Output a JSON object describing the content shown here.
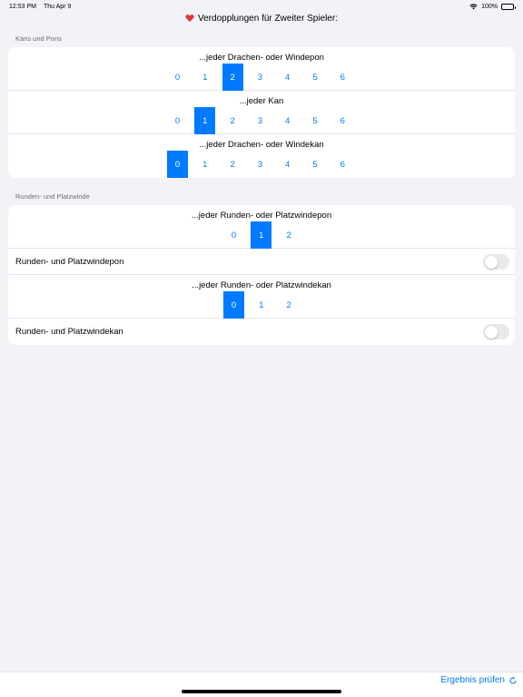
{
  "status": {
    "time": "12:53 PM",
    "date": "Thu Apr 9",
    "battery": "100%"
  },
  "nav": {
    "title": "Verdopplungen für Zweiter Spieler:",
    "icon": "heart-icon",
    "icon_color": "#e0353b"
  },
  "sections": [
    {
      "header": "Kans und Pons",
      "pickers": [
        {
          "title": "...jeder Drachen- oder Windepon",
          "options": [
            "0",
            "1",
            "2",
            "3",
            "4",
            "5",
            "6"
          ],
          "selected": 2
        },
        {
          "title": "...jeder Kan",
          "options": [
            "0",
            "1",
            "2",
            "3",
            "4",
            "5",
            "6"
          ],
          "selected": 1
        },
        {
          "title": "...jeder Drachen- oder Windekan",
          "options": [
            "0",
            "1",
            "2",
            "3",
            "4",
            "5",
            "6"
          ],
          "selected": 0
        }
      ]
    },
    {
      "header": "Runden- und Platzwinde",
      "pickers": [
        {
          "title": "...jeder Runden- oder Platzwindepon",
          "options": [
            "0",
            "1",
            "2"
          ],
          "selected": 1
        },
        {
          "title": "...jeder Runden- oder Platzwindekan",
          "options": [
            "0",
            "1",
            "2"
          ],
          "selected": 0
        }
      ],
      "toggles": [
        {
          "label": "Runden- und Platzwindepon",
          "on": false
        },
        {
          "label": "Runden- und Platzwindekan",
          "on": false
        }
      ]
    }
  ],
  "footer": {
    "check_label": "Ergebnis prüfen",
    "check_icon": "refresh-icon"
  },
  "colors": {
    "accent": "#007aff",
    "background": "#f2f2f7"
  }
}
